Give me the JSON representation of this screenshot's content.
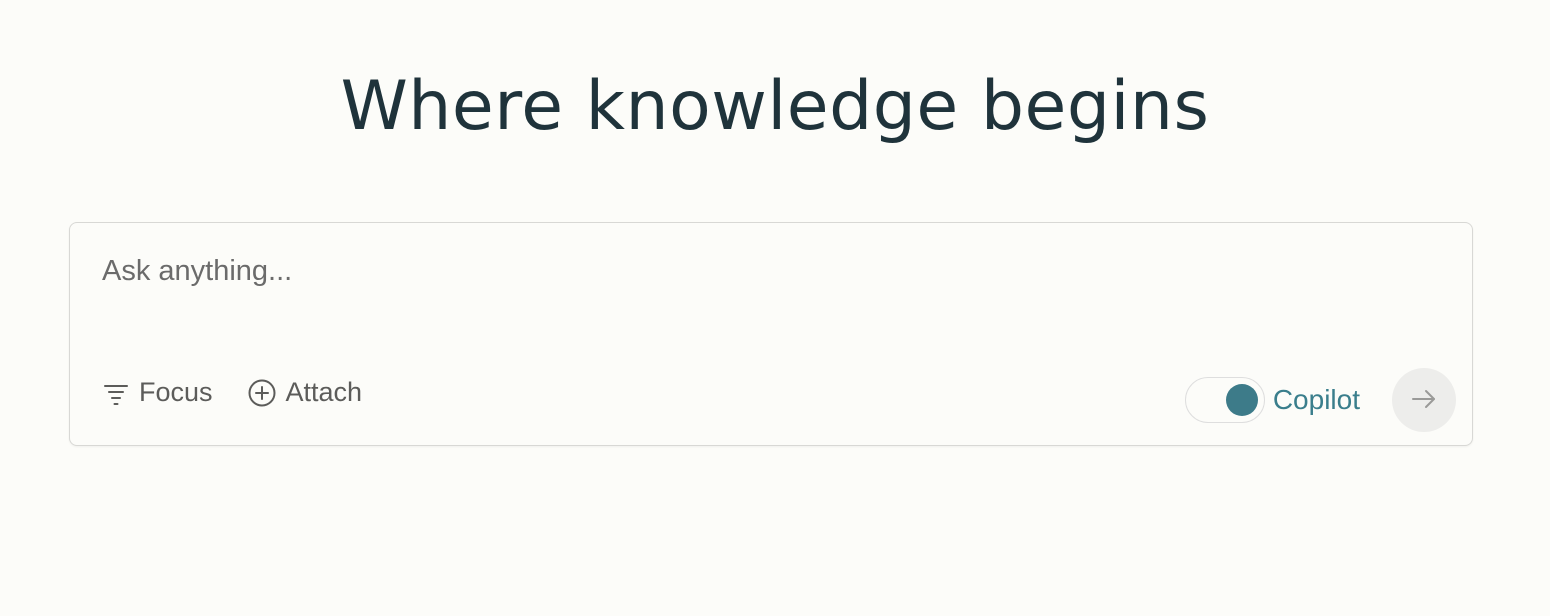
{
  "headline": "Where knowledge begins",
  "search": {
    "placeholder": "Ask anything...",
    "value": ""
  },
  "toolbar": {
    "focus_label": "Focus",
    "focus_icon": "filter-icon",
    "attach_label": "Attach",
    "attach_icon": "plus-circle-icon",
    "copilot_label": "Copilot",
    "copilot_enabled": true,
    "submit_icon": "arrow-right-icon"
  },
  "colors": {
    "background": "#fcfcf9",
    "headline": "#1f333b",
    "accent": "#3d7b89",
    "muted_text": "#5c5c5a",
    "submit_bg": "#ededeb"
  }
}
